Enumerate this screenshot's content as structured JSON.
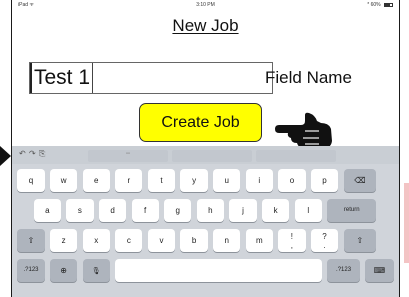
{
  "status_bar": {
    "carrier": "iPad ᯤ",
    "time": "3:10 PM",
    "battery": "* 60%"
  },
  "page": {
    "title": "New Job"
  },
  "form": {
    "name_value": "Test 1",
    "field_label": "Field Name",
    "create_button_label": "Create Job"
  },
  "keyboard": {
    "toolbar": {
      "undo": "↶",
      "redo": "↷",
      "paste": "⎘",
      "suggestion": "\"\""
    },
    "row1": [
      "q",
      "w",
      "e",
      "r",
      "t",
      "y",
      "u",
      "i",
      "o",
      "p"
    ],
    "backspace": "⌫",
    "row2": [
      "a",
      "s",
      "d",
      "f",
      "g",
      "h",
      "j",
      "k",
      "l"
    ],
    "return_label": "return",
    "shift": "⇧",
    "row3": [
      "z",
      "x",
      "c",
      "v",
      "b",
      "n",
      "m"
    ],
    "exclaim_top": "!",
    "exclaim_bottom": ",",
    "question_top": "?",
    "question_bottom": ".",
    "num_left": ".?123",
    "globe": "⊕",
    "mic": "🎙",
    "num_right": ".?123",
    "hide_keyboard": "⌨"
  }
}
